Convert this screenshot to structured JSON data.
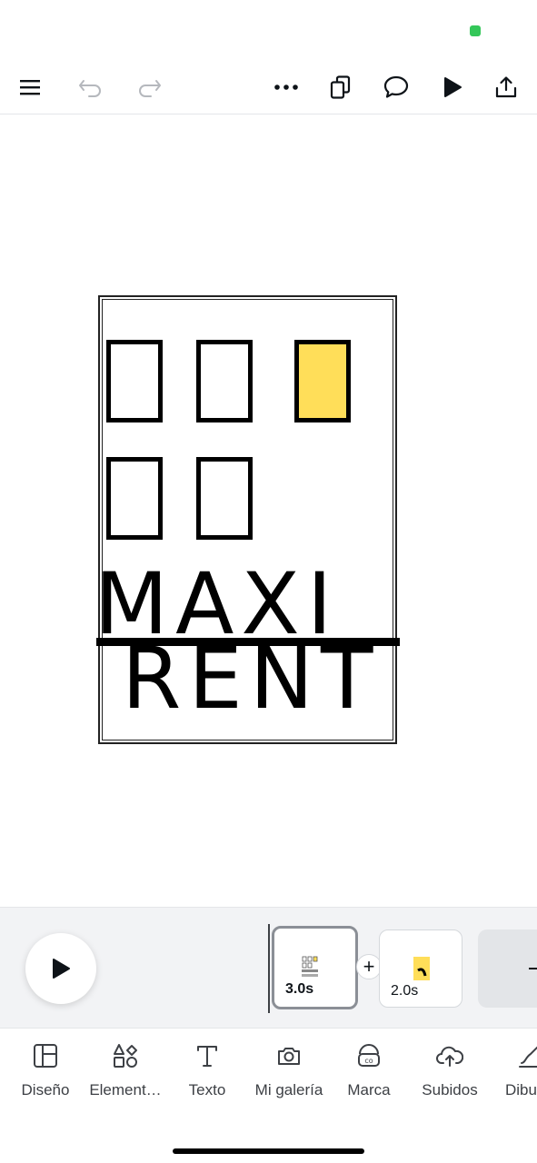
{
  "toolbar": {
    "menu_icon": "hamburger-menu-icon",
    "undo_icon": "undo-icon",
    "redo_icon": "redo-icon",
    "more_icon": "more-options-icon",
    "duplicate_icon": "pages-duplicate-icon",
    "comment_icon": "comment-icon",
    "play_icon": "play-icon",
    "share_icon": "share-icon"
  },
  "design": {
    "brand_line1": "MAXI",
    "brand_line2": "RENT",
    "window_accent_color": "#ffde59"
  },
  "timeline": {
    "clips": [
      {
        "duration": "3.0s"
      },
      {
        "duration": "2.0s"
      }
    ],
    "add_label": "+"
  },
  "bottom_nav": {
    "items": [
      {
        "label": "Diseño",
        "icon": "layout-icon"
      },
      {
        "label": "Element…",
        "icon": "elements-icon"
      },
      {
        "label": "Texto",
        "icon": "text-icon"
      },
      {
        "label": "Mi galería",
        "icon": "camera-icon"
      },
      {
        "label": "Marca",
        "icon": "brand-icon"
      },
      {
        "label": "Subidos",
        "icon": "upload-cloud-icon"
      },
      {
        "label": "Dibu",
        "icon": "draw-icon"
      }
    ]
  }
}
